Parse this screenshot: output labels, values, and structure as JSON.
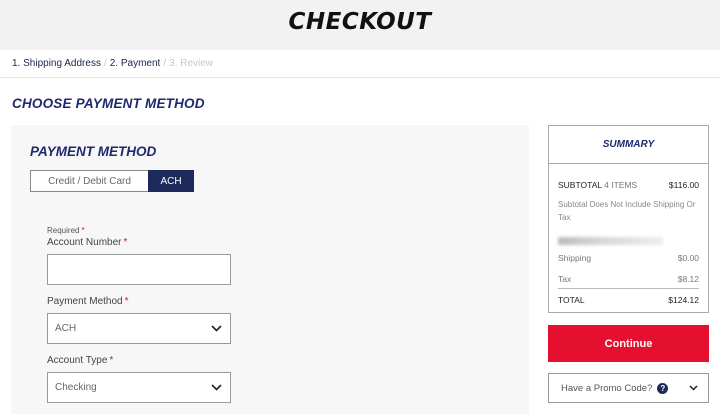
{
  "header": {
    "title": "CHECKOUT"
  },
  "breadcrumb": {
    "steps": [
      {
        "label": "1. Shipping Address"
      },
      {
        "label": "2. Payment"
      },
      {
        "label": "3. Review"
      }
    ],
    "separator": "/"
  },
  "page_heading": "CHOOSE PAYMENT METHOD",
  "payment_panel": {
    "heading": "PAYMENT METHOD",
    "toggle": {
      "card_label": "Credit / Debit Card",
      "ach_label": "ACH",
      "selected": "ACH"
    },
    "required_note": "Required",
    "required_star": "*",
    "fields": {
      "account_number": {
        "label": "Account Number",
        "value": ""
      },
      "payment_method": {
        "label": "Payment Method",
        "value": "ACH"
      },
      "account_type": {
        "label": "Account Type",
        "value": "Checking"
      }
    }
  },
  "summary": {
    "title": "SUMMARY",
    "subtotal_label": "SUBTOTAL",
    "items_count": "4 ITEMS",
    "subtotal_value": "$116.00",
    "note": "Subtotal Does Not Include Shipping Or Tax",
    "shipping_label": "Shipping",
    "shipping_value": "$0.00",
    "tax_label": "Tax",
    "tax_value": "$8.12",
    "total_label": "TOTAL",
    "total_value": "$124.12"
  },
  "continue_label": "Continue",
  "promo": {
    "label": "Have a Promo Code?",
    "help_glyph": "?"
  },
  "icons": {
    "select_chevron": "chevron-down-icon",
    "help": "question-circle-icon"
  },
  "colors": {
    "brand_navy": "#1e2a6b",
    "accent_red": "#e5102f",
    "header_bg": "#f2f2f2"
  }
}
